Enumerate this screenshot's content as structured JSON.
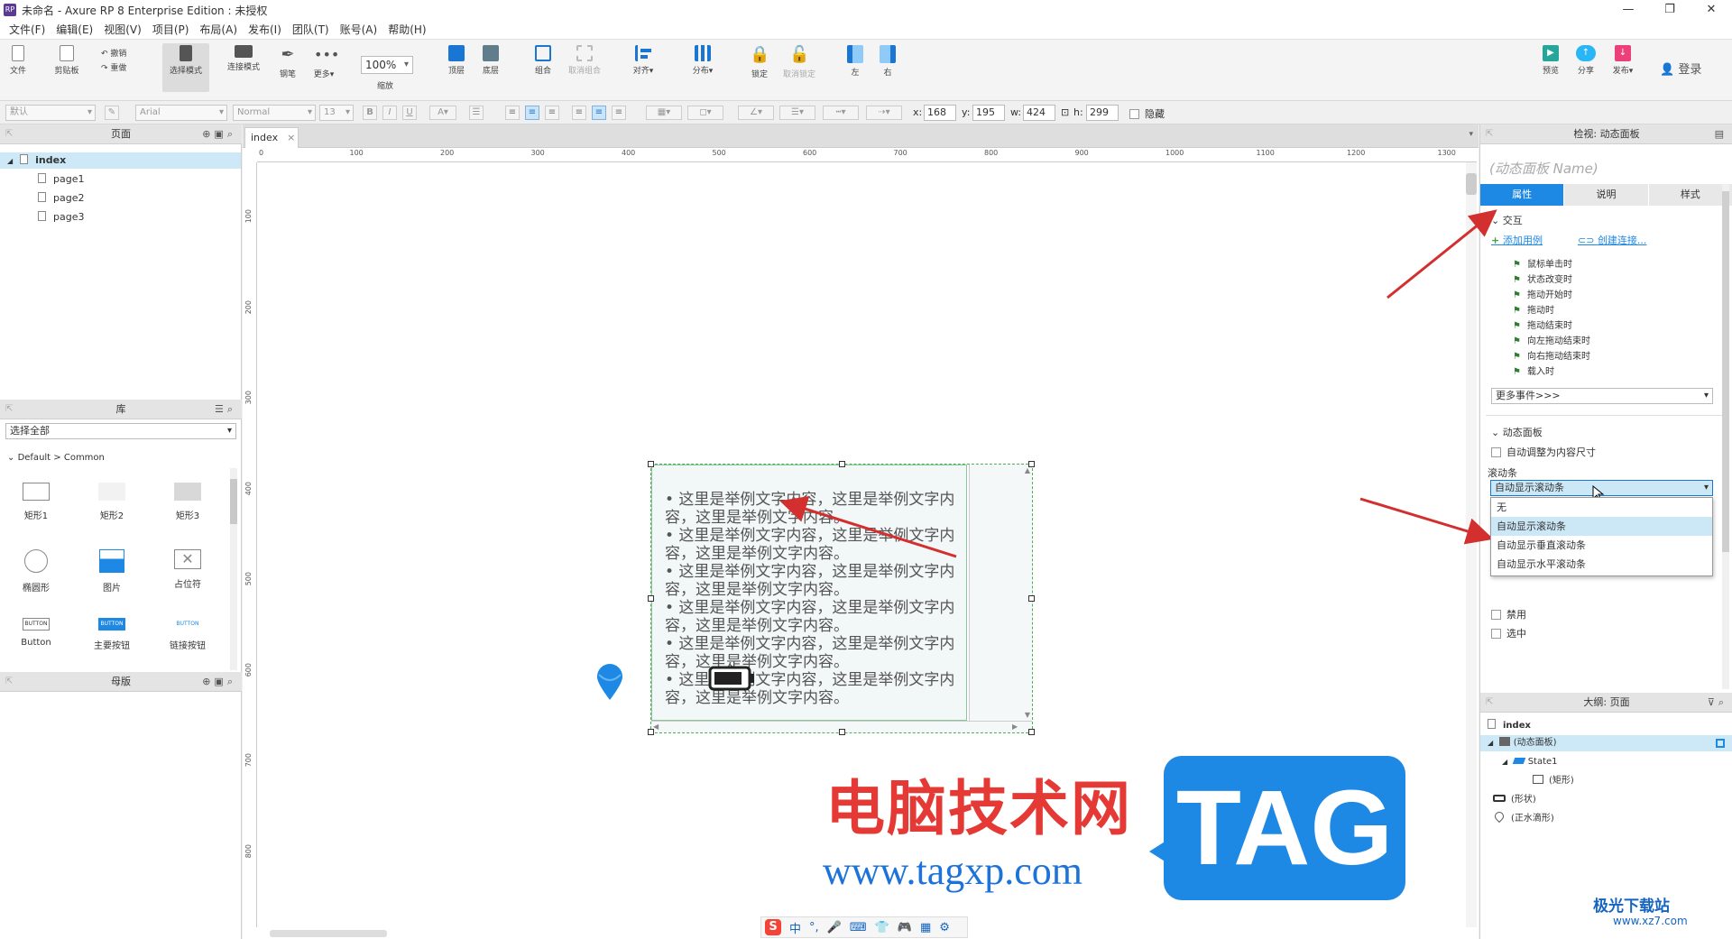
{
  "window": {
    "title": "未命名 - Axure RP 8 Enterprise Edition : 未授权",
    "icon": "RP"
  },
  "menu": [
    "文件(F)",
    "编辑(E)",
    "视图(V)",
    "项目(P)",
    "布局(A)",
    "发布(I)",
    "团队(T)",
    "账号(A)",
    "帮助(H)"
  ],
  "toolbar": {
    "file": "文件",
    "clipboard": "剪贴板",
    "undo": "撤销",
    "redo": "重做",
    "select_mode": "选择模式",
    "connect_mode": "连接模式",
    "pen": "钢笔",
    "more": "更多▾",
    "zoom": "100%",
    "zoom_label": "缩放",
    "top": "顶层",
    "bottom": "底层",
    "group": "组合",
    "ungroup": "取消组合",
    "align": "对齐▾",
    "distribute": "分布▾",
    "lock": "锁定",
    "unlock": "取消锁定",
    "left": "左",
    "right": "右",
    "preview": "预览",
    "share": "分享",
    "publish": "发布▾",
    "login": "登录"
  },
  "format": {
    "style": "默认",
    "font": "Arial",
    "weight": "Normal",
    "size": "13",
    "x_label": "x:",
    "x": "168",
    "y_label": "y:",
    "y": "195",
    "w_label": "w:",
    "w": "424",
    "h_label": "h:",
    "h": "299",
    "hidden": "隐藏"
  },
  "pages_panel": {
    "title": "页面",
    "items": [
      "index",
      "page1",
      "page2",
      "page3"
    ]
  },
  "library_panel": {
    "title": "库",
    "select": "选择全部",
    "group": "Default > Common",
    "items": [
      "矩形1",
      "矩形2",
      "矩形3",
      "椭圆形",
      "图片",
      "占位符",
      "Button",
      "主要按钮",
      "链接按钮"
    ],
    "btn_text": "BUTTON"
  },
  "masters_panel": {
    "title": "母版"
  },
  "canvas": {
    "tab": "index",
    "ruler_x": [
      "0",
      "100",
      "200",
      "300",
      "400",
      "500",
      "600",
      "700",
      "800",
      "900",
      "1000",
      "1100",
      "1200",
      "1300"
    ],
    "ruler_y": [
      "100",
      "200",
      "300",
      "400",
      "500",
      "600",
      "700",
      "800"
    ],
    "panel_lines": [
      "• 这里是举例文字内容，这里是举例文字内容，这里是举例文字内容。",
      "• 这里是举例文字内容，这里是举例文字内容，这里是举例文字内容。",
      "• 这里是举例文字内容，这里是举例文字内容，这里是举例文字内容。",
      "• 这里是举例文字内容，这里是举例文字内容，这里是举例文字内容。",
      "• 这里是举例文字内容，这里是举例文字内容，这里是举例文字内容。",
      "• 这里是举例文字内容，这里是举例文字内容，这里是举例文字内容。"
    ]
  },
  "inspector": {
    "title": "检视: 动态面板",
    "name_placeholder": "(动态面板 Name)",
    "tabs": [
      "属性",
      "说明",
      "样式"
    ],
    "interaction": "交互",
    "add_case": "添加用例",
    "create_link": "创建连接...",
    "events": [
      "鼠标单击时",
      "状态改变时",
      "拖动开始时",
      "拖动时",
      "拖动结束时",
      "向左拖动结束时",
      "向右拖动结束时",
      "载入时"
    ],
    "more_events": "更多事件>>>",
    "dyn_section": "动态面板",
    "auto_fit": "自动调整为内容尺寸",
    "scrollbar_label": "滚动条",
    "scrollbar_value": "自动显示滚动条",
    "scrollbar_options": [
      "无",
      "自动显示滚动条",
      "自动显示垂直滚动条",
      "自动显示水平滚动条"
    ],
    "disabled": "禁用",
    "selected": "选中"
  },
  "outline": {
    "title": "大纲: 页面",
    "items": [
      "index",
      "(动态面板)",
      "State1",
      "(矩形)",
      "(形状)",
      "(正水滴形)"
    ]
  },
  "watermark": {
    "cn": "电脑技术网",
    "url": "www.tagxp.com",
    "tag": "TAG",
    "site2": "极光下载站",
    "site2_url": "www.xz7.com"
  },
  "ime": [
    "中",
    "°,",
    "🎤",
    "⌨",
    "👕",
    "🎮",
    "▦",
    "⚙"
  ],
  "colors": {
    "accent": "#1e88e5",
    "arrow": "#d32f2f",
    "panel_border": "#4caf50"
  }
}
